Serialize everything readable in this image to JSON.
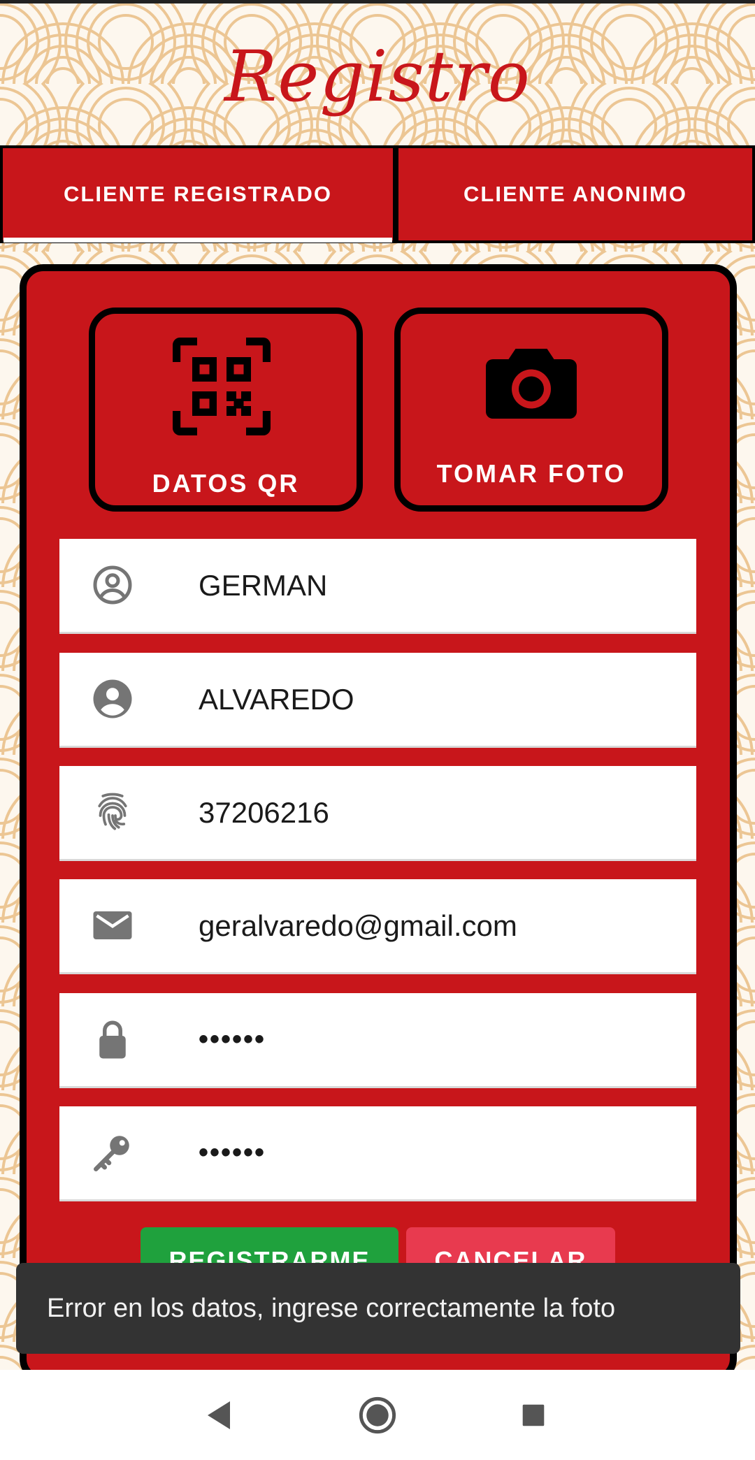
{
  "header": {
    "title": "Registro"
  },
  "tabs": [
    {
      "label": "CLIENTE REGISTRADO",
      "selected": true
    },
    {
      "label": "CLIENTE ANONIMO",
      "selected": false
    }
  ],
  "actions": {
    "qr_label": "DATOS QR",
    "photo_label": "TOMAR FOTO"
  },
  "form": {
    "nombre": {
      "icon": "account-circle-outline-icon",
      "value": "GERMAN"
    },
    "apellido": {
      "icon": "account-circle-icon",
      "value": "ALVAREDO"
    },
    "dni": {
      "icon": "fingerprint-icon",
      "value": "37206216"
    },
    "email": {
      "icon": "email-icon",
      "value": "geralvaredo@gmail.com"
    },
    "password": {
      "icon": "lock-icon",
      "value": "••••••"
    },
    "password_confirm": {
      "icon": "key-icon",
      "value": "••••••"
    }
  },
  "buttons": {
    "register_label": "REGISTRARME",
    "cancel_label": "CANCELAR"
  },
  "toast": {
    "message": "Error en los datos, ingrese correctamente la foto"
  },
  "navbar": {
    "back": "back-icon",
    "home": "home-icon",
    "recents": "recents-icon"
  },
  "colors": {
    "primary_red": "#c8161b",
    "register_green": "#1fa13d",
    "cancel_pink": "#e83a4f",
    "toast_bg": "#333333",
    "pattern_gold": "#e3b06a"
  }
}
